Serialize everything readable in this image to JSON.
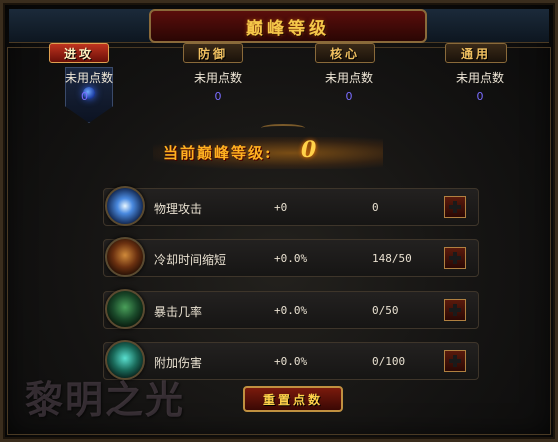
{
  "title": "巅峰等级",
  "tabs": [
    {
      "label": "进攻",
      "active": true
    },
    {
      "label": "防御",
      "active": false
    },
    {
      "label": "核心",
      "active": false
    },
    {
      "label": "通用",
      "active": false
    }
  ],
  "columns": [
    {
      "label": "未用点数",
      "value": "0"
    },
    {
      "label": "未用点数",
      "value": "0"
    },
    {
      "label": "未用点数",
      "value": "0"
    },
    {
      "label": "未用点数",
      "value": "0"
    }
  ],
  "level": {
    "label": "当前巅峰等级:",
    "value": "0"
  },
  "stats": [
    {
      "name": "物理攻击",
      "bonus": "+0",
      "points": "0",
      "icon": "lightning-orb-icon"
    },
    {
      "name": "冷却时间缩短",
      "bonus": "+0.0%",
      "points": "148/50",
      "icon": "warrior-portrait-icon"
    },
    {
      "name": "暴击几率",
      "bonus": "+0.0%",
      "points": "0/50",
      "icon": "rogue-portrait-icon"
    },
    {
      "name": "附加伤害",
      "bonus": "+0.0%",
      "points": "0/100",
      "icon": "spirit-portrait-icon"
    }
  ],
  "reset_label": "重置点数",
  "watermark": "黎明之光",
  "colors": {
    "accent": "#ffd24a",
    "active_tab": "#c0341f",
    "points_value": "#7a6cff"
  }
}
